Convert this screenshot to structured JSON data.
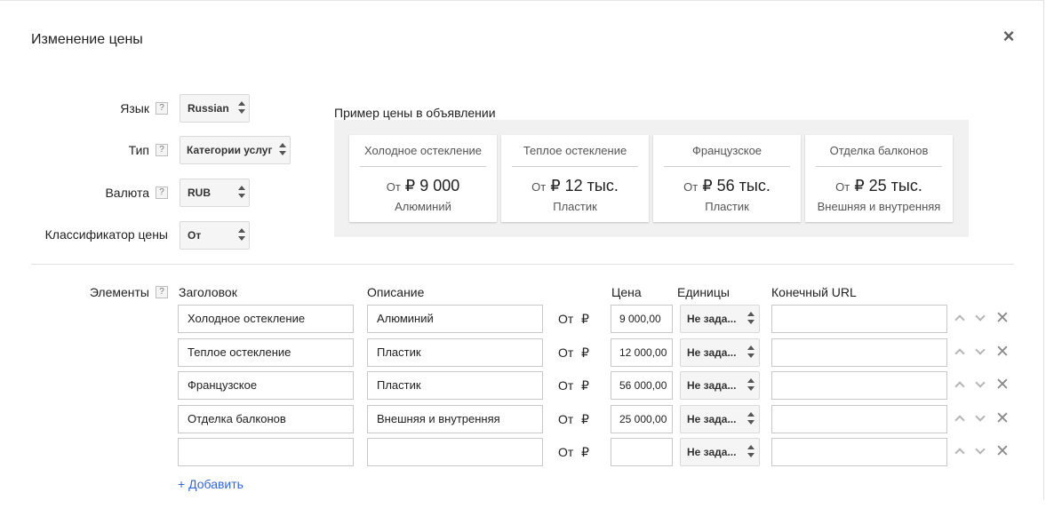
{
  "dialog": {
    "title": "Изменение цены",
    "close_icon": "close-icon",
    "close_label": "×"
  },
  "settings": {
    "help_label": "?",
    "language": {
      "label": "Язык",
      "value": "Russian"
    },
    "type": {
      "label": "Тип",
      "value": "Категории услуг"
    },
    "currency": {
      "label": "Валюта",
      "value": "RUB"
    },
    "qualifier": {
      "label": "Классификатор цены",
      "value": "От"
    }
  },
  "preview": {
    "title": "Пример цены в объявлении",
    "cards": [
      {
        "header": "Холодное остекление",
        "from": "От",
        "price": "₽ 9 000",
        "description": "Алюминий"
      },
      {
        "header": "Теплое остекление",
        "from": "От",
        "price": "₽ 12 тыс.",
        "description": "Пластик"
      },
      {
        "header": "Французское",
        "from": "От",
        "price": "₽ 56 тыс.",
        "description": "Пластик"
      },
      {
        "header": "Отделка балконов",
        "from": "От",
        "price": "₽ 25 тыс.",
        "description": "Внешняя и внутренняя"
      }
    ]
  },
  "elements": {
    "label": "Элементы",
    "columns": {
      "header": "Заголовок",
      "description": "Описание",
      "price": "Цена",
      "units": "Единицы",
      "final_url": "Конечный URL"
    },
    "rows": [
      {
        "header": "Холодное остекление",
        "description": "Алюминий",
        "from": "От",
        "currency": "₽",
        "price": "9 000,00",
        "units": "Не зада...",
        "url": ""
      },
      {
        "header": "Теплое остекление",
        "description": "Пластик",
        "from": "От",
        "currency": "₽",
        "price": "12 000,00",
        "units": "Не зада...",
        "url": ""
      },
      {
        "header": "Французское",
        "description": "Пластик",
        "from": "От",
        "currency": "₽",
        "price": "56 000,00",
        "units": "Не зада...",
        "url": ""
      },
      {
        "header": "Отделка балконов",
        "description": "Внешняя и внутренняя",
        "from": "От",
        "currency": "₽",
        "price": "25 000,00",
        "units": "Не зада...",
        "url": ""
      },
      {
        "header": "",
        "description": "",
        "from": "От",
        "currency": "₽",
        "price": "",
        "units": "Не зада...",
        "url": ""
      }
    ],
    "row_icons": {
      "up": "chevron-up-icon",
      "down": "chevron-down-icon",
      "delete": "delete-icon",
      "delete_label": "✕"
    },
    "add_label": "+ Добавить"
  }
}
